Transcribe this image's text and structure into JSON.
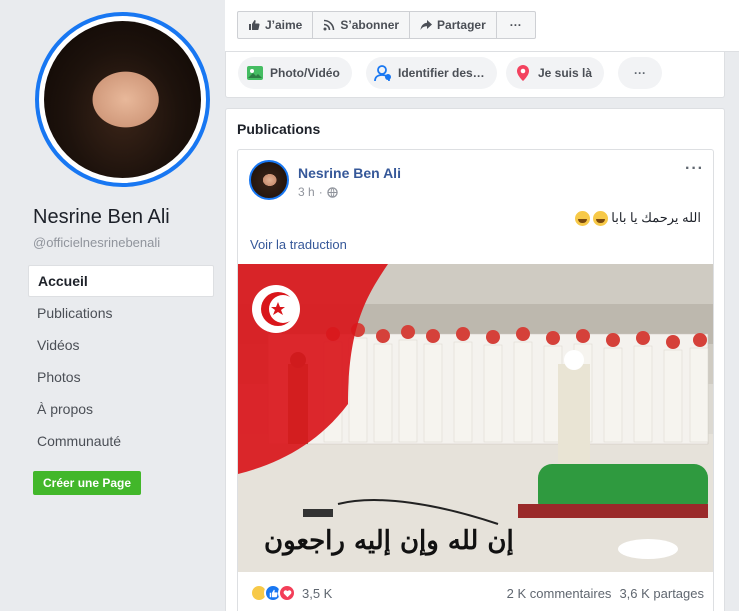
{
  "profile": {
    "name": "Nesrine Ben Ali",
    "handle": "@officielnesrinebenali"
  },
  "nav": {
    "items": [
      {
        "label": "Accueil",
        "active": true
      },
      {
        "label": "Publications"
      },
      {
        "label": "Vidéos"
      },
      {
        "label": "Photos"
      },
      {
        "label": "À propos"
      },
      {
        "label": "Communauté"
      }
    ],
    "create_page": "Créer une Page"
  },
  "actions": {
    "like": "J’aime",
    "subscribe": "S’abonner",
    "share": "Partager",
    "more": "···"
  },
  "composer": {
    "photo": "Photo/Vidéo",
    "tag": "Identifier des…",
    "checkin": "Je suis là",
    "more": "···"
  },
  "publications": {
    "title": "Publications"
  },
  "post": {
    "author": "Nesrine Ben Ali",
    "time": "3 h",
    "privacy_sep": "·",
    "more": "···",
    "text": "الله يرحمك يا بابا",
    "translate": "Voir la traduction",
    "image_caption": "إن لله وإن إليه راجعون",
    "reaction_count": "3,5 K",
    "comments": "2 K commentaires",
    "shares": "3,6 K partages"
  },
  "colors": {
    "accent": "#1877f2",
    "link": "#365899",
    "create_button": "#42b72a",
    "background": "#e9ebee"
  }
}
